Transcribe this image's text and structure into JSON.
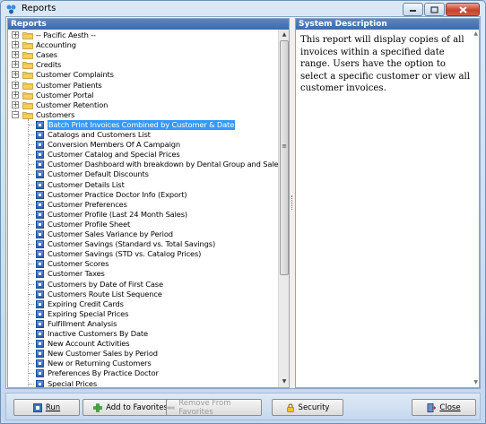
{
  "window": {
    "title": "Reports"
  },
  "left_pane": {
    "header": "Reports"
  },
  "right_pane": {
    "header": "System Description",
    "description": "This report will display copies of all invoices within a specified date range. Users have the option to select a specific customer or view all customer invoices."
  },
  "tree": {
    "folders": [
      {
        "label": "-- Pacific Aesth --"
      },
      {
        "label": "Accounting"
      },
      {
        "label": "Cases"
      },
      {
        "label": "Credits"
      },
      {
        "label": "Customer Complaints"
      },
      {
        "label": "Customer Patients"
      },
      {
        "label": "Customer Portal"
      },
      {
        "label": "Customer Retention"
      },
      {
        "label": "Customers"
      }
    ],
    "reports": [
      {
        "label": "Batch Print Invoices Combined by Customer & Date"
      },
      {
        "label": "Catalogs and Customers List"
      },
      {
        "label": "Conversion Members Of A Campaign"
      },
      {
        "label": "Customer Catalog and Special Prices"
      },
      {
        "label": "Customer Dashboard with breakdown by Dental Group and Sales Rep"
      },
      {
        "label": "Customer Default Discounts"
      },
      {
        "label": "Customer Details List"
      },
      {
        "label": "Customer Practice Doctor Info (Export)"
      },
      {
        "label": "Customer Preferences"
      },
      {
        "label": "Customer Profile (Last 24 Month Sales)"
      },
      {
        "label": "Customer Profile Sheet"
      },
      {
        "label": "Customer Sales Variance by Period"
      },
      {
        "label": "Customer Savings (Standard vs. Total Savings)"
      },
      {
        "label": "Customer Savings (STD vs. Catalog Prices)"
      },
      {
        "label": "Customer Scores"
      },
      {
        "label": "Customer Taxes"
      },
      {
        "label": "Customers by Date of First Case"
      },
      {
        "label": "Customers Route List Sequence"
      },
      {
        "label": "Expiring Credit Cards"
      },
      {
        "label": "Expiring Special Prices"
      },
      {
        "label": "Fulfillment Analysis"
      },
      {
        "label": "Inactive Customers By Date"
      },
      {
        "label": "New Account Activities"
      },
      {
        "label": "New Customer Sales by Period"
      },
      {
        "label": "New or Returning Customers"
      },
      {
        "label": "Preferences By Practice Doctor"
      },
      {
        "label": "Special Prices"
      }
    ],
    "selected_report": "Batch Print Invoices Combined by Customer & Date"
  },
  "buttons": {
    "run": "Run",
    "add_favorites": "Add to Favorites",
    "remove_favorites": "Remove From Favorites",
    "security": "Security",
    "close": "Close"
  }
}
